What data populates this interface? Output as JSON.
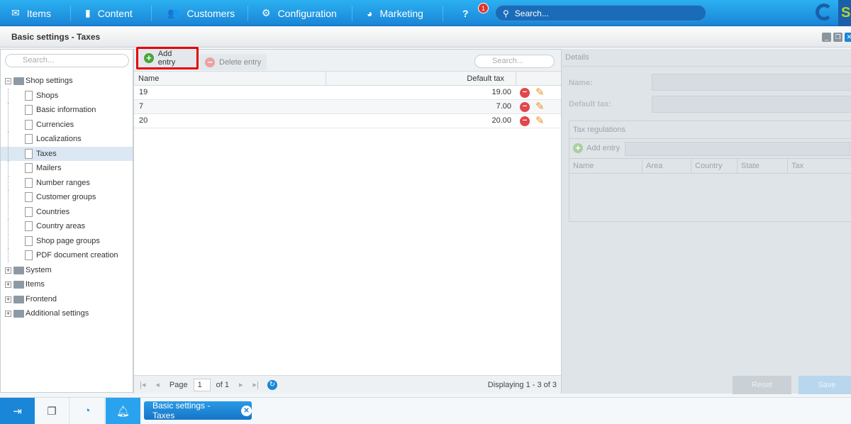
{
  "nav": {
    "items": [
      {
        "label": "Items",
        "icon": "inbox-icon"
      },
      {
        "label": "Content",
        "icon": "document-icon"
      },
      {
        "label": "Customers",
        "icon": "users-icon"
      },
      {
        "label": "Configuration",
        "icon": "gear-icon"
      },
      {
        "label": "Marketing",
        "icon": "pie-chart-icon"
      }
    ],
    "notification_count": "1",
    "search_placeholder": "Search..."
  },
  "window": {
    "title": "Basic settings - Taxes"
  },
  "tree": {
    "search_placeholder": "Search...",
    "root": "Shop settings",
    "children": [
      "Shops",
      "Basic information",
      "Currencies",
      "Localizations",
      "Taxes",
      "Mailers",
      "Number ranges",
      "Customer groups",
      "Countries",
      "Country areas",
      "Shop page groups",
      "PDF document creation"
    ],
    "selected": "Taxes",
    "others": [
      "System",
      "Items",
      "Frontend",
      "Additional settings"
    ]
  },
  "grid": {
    "add_label": "Add entry",
    "delete_label": "Delete entry",
    "search_placeholder": "Search...",
    "columns": [
      "Name",
      "Default tax"
    ],
    "rows": [
      {
        "name": "19",
        "tax": "19.00"
      },
      {
        "name": "7",
        "tax": "7.00"
      },
      {
        "name": "20",
        "tax": "20.00"
      }
    ],
    "pager": {
      "page_label": "Page",
      "page": "1",
      "of": "of 1",
      "display": "Displaying 1 - 3 of 3"
    }
  },
  "details": {
    "title": "Details",
    "name_label": "Name:",
    "tax_label": "Default tax:",
    "regulations": {
      "title": "Tax regulations",
      "add_label": "Add entry",
      "columns": [
        "Name",
        "Area",
        "Country",
        "State",
        "Tax"
      ]
    },
    "reset": "Reset",
    "save": "Save"
  },
  "taskbar": {
    "task": "Basic settings - Taxes"
  },
  "colors": {
    "accent": "#1a86d8",
    "highlight": "#e60000"
  }
}
